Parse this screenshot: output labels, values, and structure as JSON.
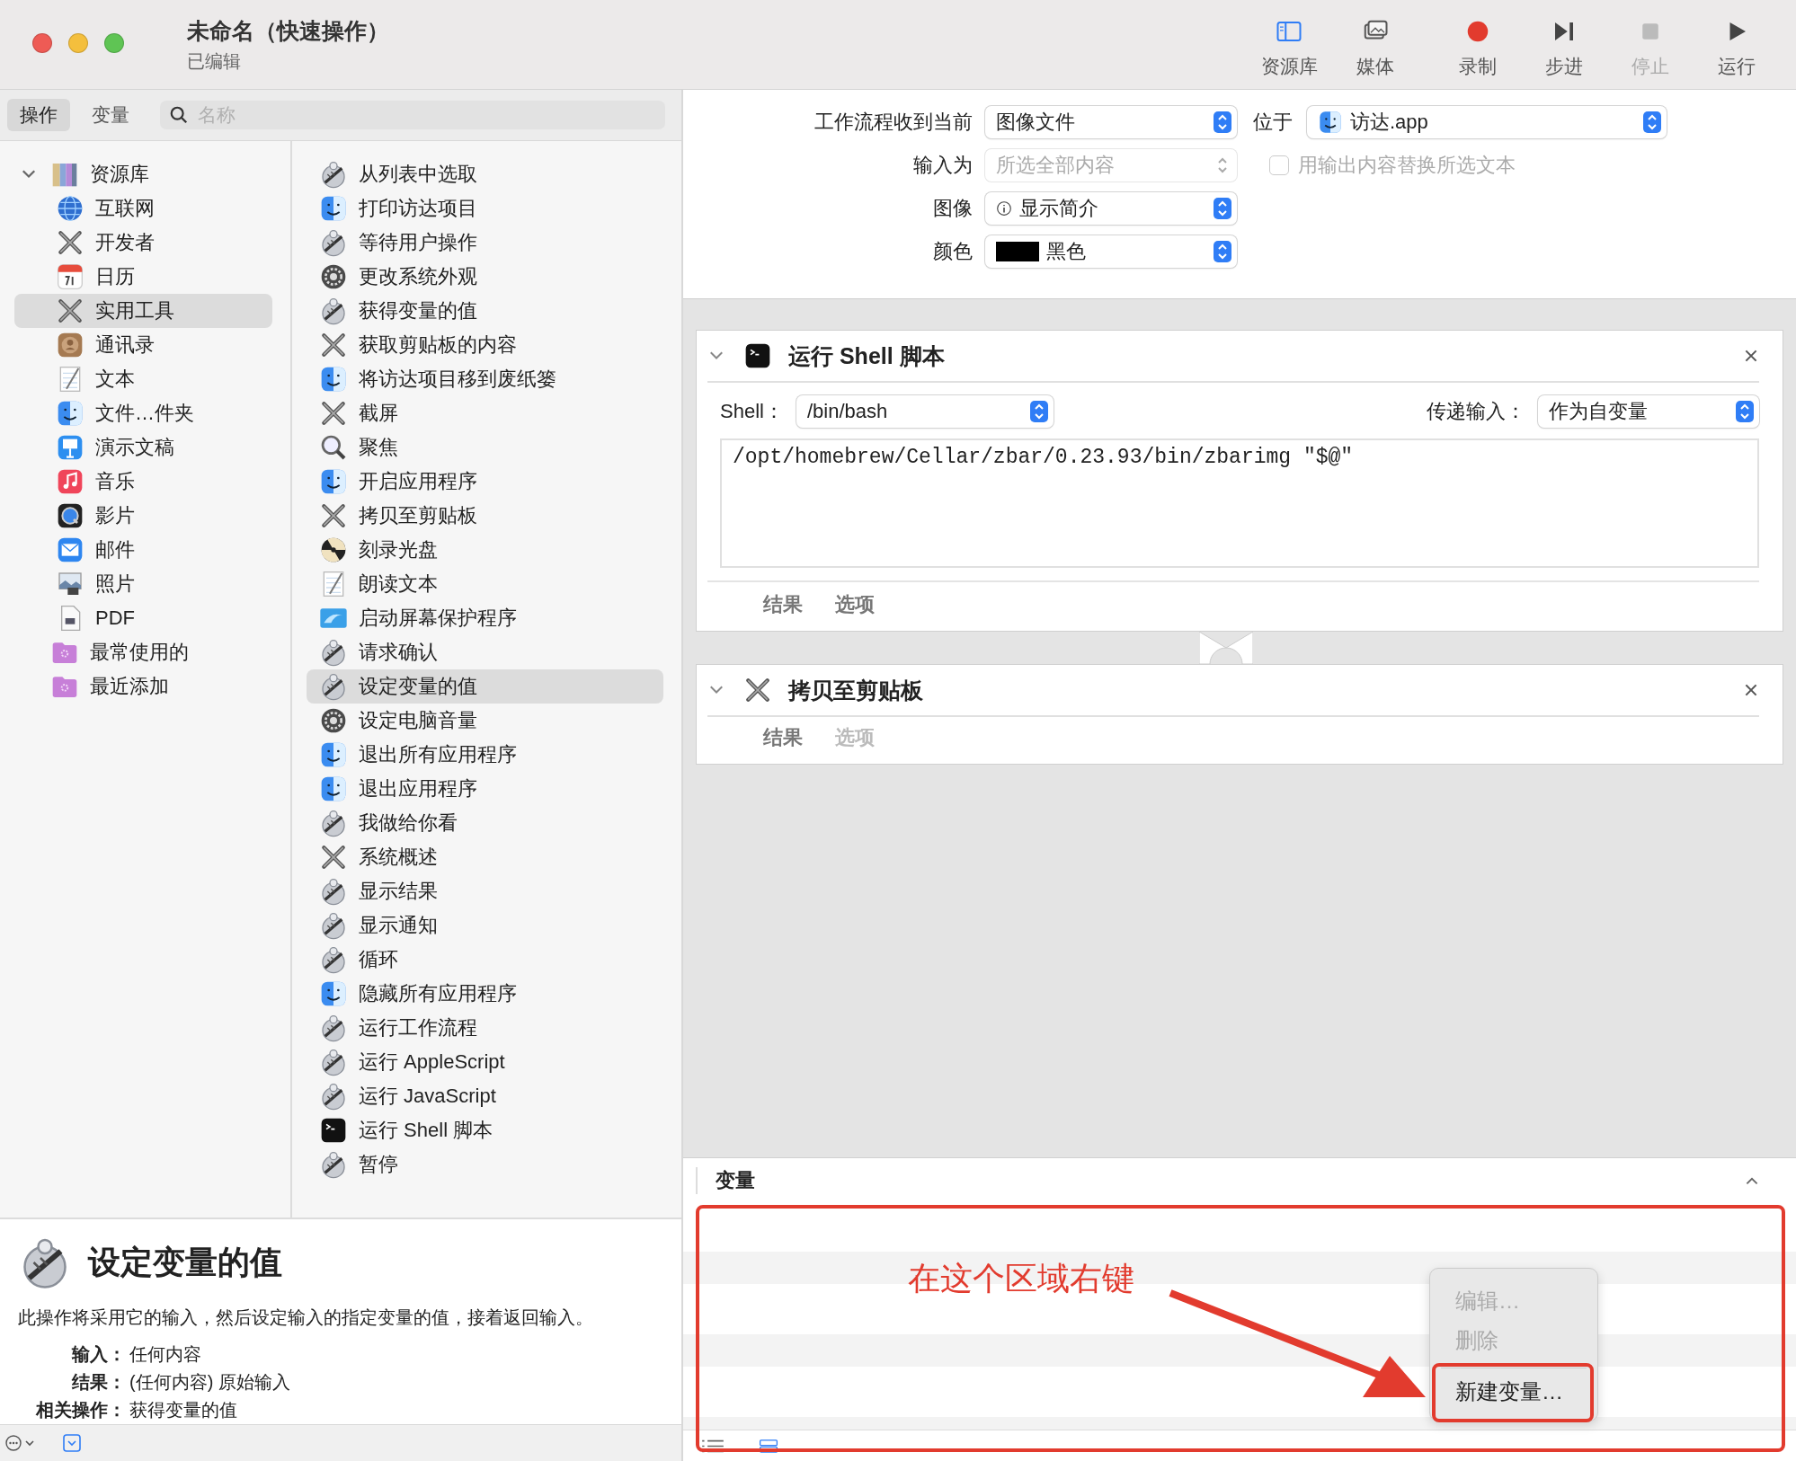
{
  "window": {
    "title": "未命名（快速操作）",
    "subtitle": "已编辑"
  },
  "toolbar": [
    {
      "kind": "library",
      "label": "资源库",
      "disabled": false
    },
    {
      "kind": "media",
      "label": "媒体",
      "disabled": false
    },
    {
      "kind": "record",
      "label": "录制",
      "disabled": false
    },
    {
      "kind": "step",
      "label": "步进",
      "disabled": false
    },
    {
      "kind": "stop",
      "label": "停止",
      "disabled": true
    },
    {
      "kind": "run",
      "label": "运行",
      "disabled": false
    }
  ],
  "left_tabs": [
    {
      "label": "操作",
      "selected": true
    },
    {
      "label": "变量",
      "selected": false
    }
  ],
  "search": {
    "placeholder": "名称"
  },
  "library": [
    {
      "label": "资源库",
      "kind": "books",
      "selected": false,
      "expanded": true,
      "children": [
        {
          "label": "互联网",
          "kind": "globe",
          "selected": false
        },
        {
          "label": "开发者",
          "kind": "tools",
          "selected": false
        },
        {
          "label": "日历",
          "kind": "calendar",
          "selected": false
        },
        {
          "label": "实用工具",
          "kind": "tools",
          "selected": true
        },
        {
          "label": "通讯录",
          "kind": "contacts",
          "selected": false
        },
        {
          "label": "文本",
          "kind": "document",
          "selected": false
        },
        {
          "label": "文件…件夹",
          "kind": "face",
          "selected": false
        },
        {
          "label": "演示文稿",
          "kind": "presentation",
          "selected": false
        },
        {
          "label": "音乐",
          "kind": "music",
          "selected": false
        },
        {
          "label": "影片",
          "kind": "movie",
          "selected": false
        },
        {
          "label": "邮件",
          "kind": "mail",
          "selected": false
        },
        {
          "label": "照片",
          "kind": "photo",
          "selected": false
        },
        {
          "label": "PDF",
          "kind": "pdf",
          "selected": false
        }
      ]
    },
    {
      "label": "最常使用的",
      "kind": "folder",
      "selected": false
    },
    {
      "label": "最近添加",
      "kind": "folder",
      "selected": false
    }
  ],
  "actions": [
    {
      "label": "从列表中选取",
      "kind": "wand",
      "selected": false
    },
    {
      "label": "打印访达项目",
      "kind": "face",
      "selected": false
    },
    {
      "label": "等待用户操作",
      "kind": "wand",
      "selected": false
    },
    {
      "label": "更改系统外观",
      "kind": "gear",
      "selected": false
    },
    {
      "label": "获得变量的值",
      "kind": "wand",
      "selected": false
    },
    {
      "label": "获取剪贴板的内容",
      "kind": "tools",
      "selected": false
    },
    {
      "label": "将访达项目移到废纸篓",
      "kind": "face",
      "selected": false
    },
    {
      "label": "截屏",
      "kind": "tools",
      "selected": false
    },
    {
      "label": "聚焦",
      "kind": "search",
      "selected": false
    },
    {
      "label": "开启应用程序",
      "kind": "face",
      "selected": false
    },
    {
      "label": "拷贝至剪贴板",
      "kind": "tools",
      "selected": false
    },
    {
      "label": "刻录光盘",
      "kind": "disc",
      "selected": false
    },
    {
      "label": "朗读文本",
      "kind": "document",
      "selected": false
    },
    {
      "label": "启动屏幕保护程序",
      "kind": "screen",
      "selected": false
    },
    {
      "label": "请求确认",
      "kind": "wand",
      "selected": false
    },
    {
      "label": "设定变量的值",
      "kind": "wand",
      "selected": true
    },
    {
      "label": "设定电脑音量",
      "kind": "gear",
      "selected": false
    },
    {
      "label": "退出所有应用程序",
      "kind": "face",
      "selected": false
    },
    {
      "label": "退出应用程序",
      "kind": "face",
      "selected": false
    },
    {
      "label": "我做给你看",
      "kind": "wand",
      "selected": false
    },
    {
      "label": "系统概述",
      "kind": "tools",
      "selected": false
    },
    {
      "label": "显示结果",
      "kind": "wand",
      "selected": false
    },
    {
      "label": "显示通知",
      "kind": "wand",
      "selected": false
    },
    {
      "label": "循环",
      "kind": "wand",
      "selected": false
    },
    {
      "label": "隐藏所有应用程序",
      "kind": "face",
      "selected": false
    },
    {
      "label": "运行工作流程",
      "kind": "wand",
      "selected": false
    },
    {
      "label": "运行 AppleScript",
      "kind": "wand",
      "selected": false
    },
    {
      "label": "运行 JavaScript",
      "kind": "wand",
      "selected": false
    },
    {
      "label": "运行 Shell 脚本",
      "kind": "terminal",
      "selected": false
    },
    {
      "label": "暂停",
      "kind": "wand",
      "selected": false
    }
  ],
  "description": {
    "kind": "wand",
    "title": "设定变量的值",
    "text": "此操作将采用它的输入，然后设定输入的指定变量的值，接着返回输入。",
    "details": [
      {
        "label": "输入：",
        "value": "任何内容"
      },
      {
        "label": "结果：",
        "value": "(任何内容) 原始输入"
      },
      {
        "label": "相关操作：",
        "value": "获得变量的值"
      }
    ]
  },
  "settings": {
    "receives": {
      "label": "工作流程收到当前",
      "value": "图像文件"
    },
    "location": {
      "label": "位于",
      "value": "访达.app"
    },
    "input": {
      "label": "输入为",
      "value": "所选全部内容",
      "disabled": true
    },
    "replace": {
      "label": "用输出内容替换所选文本",
      "checked": false,
      "disabled": true
    },
    "image": {
      "label": "图像",
      "value": "显示简介"
    },
    "color": {
      "label": "颜色",
      "value": "黑色",
      "color": "#000000"
    }
  },
  "cards": [
    {
      "title": "运行 Shell 脚本",
      "kind": "terminal",
      "expanded": true,
      "shell": {
        "label": "Shell：",
        "value": "/bin/bash"
      },
      "pass_input": {
        "label": "传递输入：",
        "value": "作为自变量"
      },
      "script": "/opt/homebrew/Cellar/zbar/0.23.93/bin/zbarimg \"$@\"",
      "tabs": [
        {
          "label": "结果",
          "disabled": false
        },
        {
          "label": "选项",
          "disabled": false
        }
      ]
    },
    {
      "title": "拷贝至剪贴板",
      "kind": "tools",
      "expanded": true,
      "tabs": [
        {
          "label": "结果",
          "disabled": false
        },
        {
          "label": "选项",
          "disabled": true
        }
      ]
    }
  ],
  "variables": {
    "title": "变量"
  },
  "context_menu": [
    {
      "label": "编辑…",
      "disabled": true
    },
    {
      "label": "删除",
      "disabled": true
    },
    {
      "label": "新建变量…",
      "disabled": false
    }
  ],
  "annotation": {
    "text": "在这个区域右键"
  }
}
